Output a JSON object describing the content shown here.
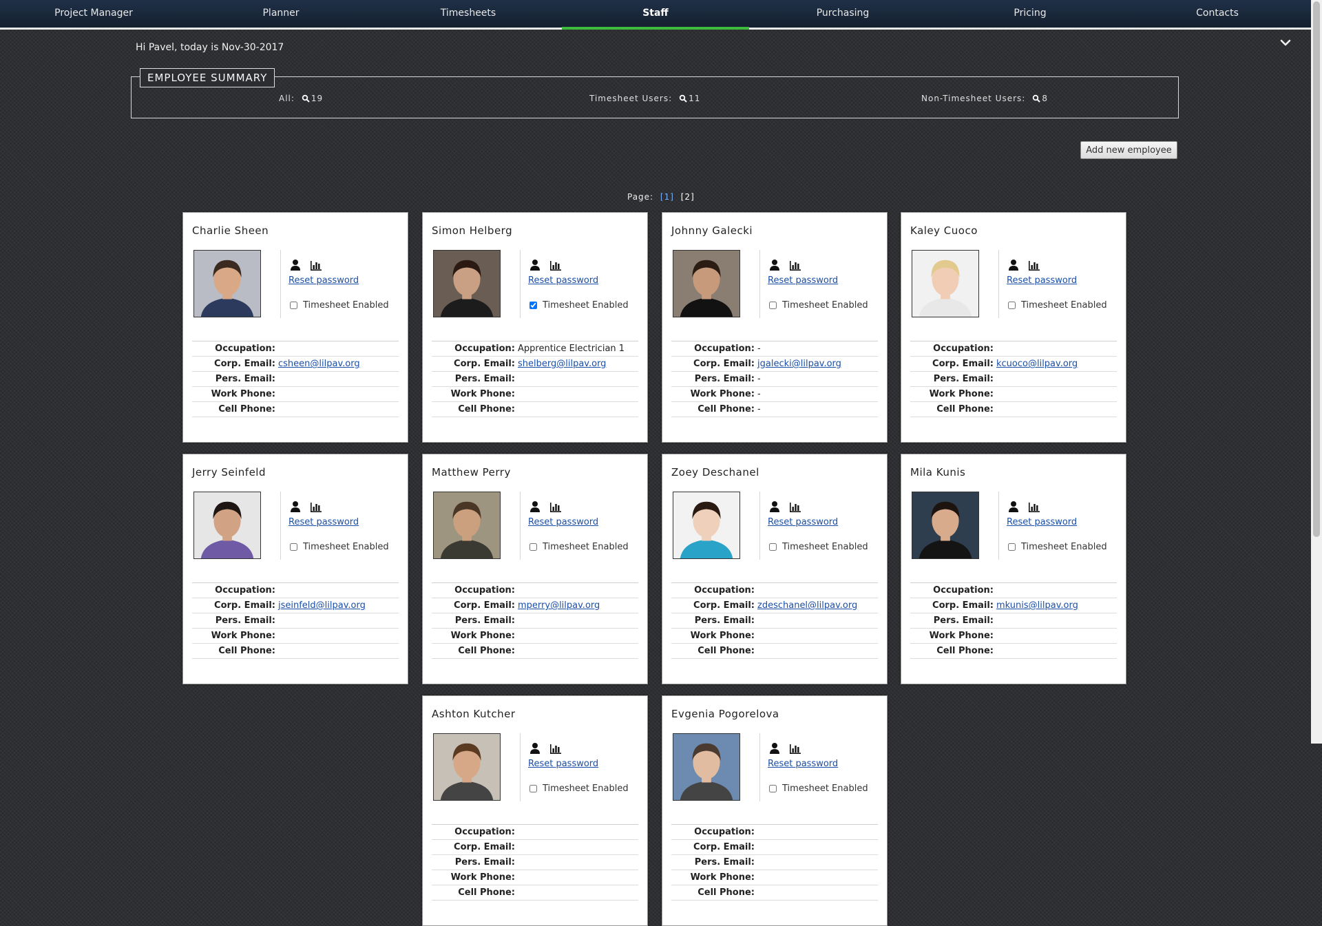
{
  "nav": [
    "Project Manager",
    "Planner",
    "Timesheets",
    "Staff",
    "Purchasing",
    "Pricing",
    "Contacts"
  ],
  "nav_active": "Staff",
  "greeting": "Hi Pavel, today is Nov-30-2017",
  "summary": {
    "title": "EMPLOYEE SUMMARY",
    "all_label": "All:",
    "all_count": "19",
    "ts_label": "Timesheet Users:",
    "ts_count": "11",
    "nts_label": "Non-Timesheet Users:",
    "nts_count": "8"
  },
  "add_button": "Add new employee",
  "pager": {
    "label": "Page:",
    "current": "[1]",
    "other": "[2]"
  },
  "card_labels": {
    "reset": "Reset password",
    "timesheet": "Timesheet Enabled",
    "occupation": "Occupation:",
    "corp_email": "Corp. Email:",
    "pers_email": "Pers. Email:",
    "work_phone": "Work Phone:",
    "cell_phone": "Cell Phone:"
  },
  "employees": [
    {
      "name": "Charlie Sheen",
      "timesheet": false,
      "occupation": "",
      "corp_email": "csheen@lilpav.org",
      "pers_email": "",
      "work_phone": "",
      "cell_phone": "",
      "hair": "#3a2a20",
      "skin": "#d9a987",
      "shirt": "#2c3a5e",
      "bg": "#b9bcc4"
    },
    {
      "name": "Simon Helberg",
      "timesheet": true,
      "occupation": "Apprentice Electrician 1",
      "corp_email": "shelberg@lilpav.org",
      "pers_email": "",
      "work_phone": "",
      "cell_phone": "",
      "hair": "#2a1a12",
      "skin": "#caa084",
      "shirt": "#1c1c1c",
      "bg": "#6a5e54"
    },
    {
      "name": "Johnny Galecki",
      "timesheet": false,
      "occupation": "-",
      "corp_email": "jgalecki@lilpav.org",
      "pers_email": "-",
      "work_phone": "-",
      "cell_phone": "-",
      "hair": "#2b1d14",
      "skin": "#c89a7c",
      "shirt": "#121212",
      "bg": "#8a7d72"
    },
    {
      "name": "Kaley Cuoco",
      "timesheet": false,
      "occupation": "",
      "corp_email": "kcuoco@lilpav.org",
      "pers_email": "",
      "work_phone": "",
      "cell_phone": "",
      "hair": "#e2c98e",
      "skin": "#f0cdb4",
      "shirt": "#e8e8e8",
      "bg": "#f1f1f1"
    },
    {
      "name": "Jerry Seinfeld",
      "timesheet": false,
      "occupation": "",
      "corp_email": "jseinfeld@lilpav.org",
      "pers_email": "",
      "work_phone": "",
      "cell_phone": "",
      "hair": "#1e1612",
      "skin": "#d1a283",
      "shirt": "#6f5aa6",
      "bg": "#e6e6e6"
    },
    {
      "name": "Matthew Perry",
      "timesheet": false,
      "occupation": "",
      "corp_email": "mperry@lilpav.org",
      "pers_email": "",
      "work_phone": "",
      "cell_phone": "",
      "hair": "#4a3624",
      "skin": "#caa07e",
      "shirt": "#3a3a32",
      "bg": "#9d9580"
    },
    {
      "name": "Zoey Deschanel",
      "timesheet": false,
      "occupation": "",
      "corp_email": "zdeschanel@lilpav.org",
      "pers_email": "",
      "work_phone": "",
      "cell_phone": "",
      "hair": "#2a1a12",
      "skin": "#efd0bb",
      "shirt": "#2aa3c9",
      "bg": "#f2f2f2"
    },
    {
      "name": "Mila Kunis",
      "timesheet": false,
      "occupation": "",
      "corp_email": "mkunis@lilpav.org",
      "pers_email": "",
      "work_phone": "",
      "cell_phone": "",
      "hair": "#1d1410",
      "skin": "#d8ab8c",
      "shirt": "#141414",
      "bg": "#2e3e4e"
    },
    {
      "name": "Ashton Kutcher",
      "timesheet": false,
      "occupation": "",
      "corp_email": "",
      "pers_email": "",
      "work_phone": "",
      "cell_phone": "",
      "hair": "#5a3a20",
      "skin": "#d7a888",
      "shirt": "#444",
      "bg": "#c6c0b6"
    },
    {
      "name": "Evgenia Pogorelova",
      "timesheet": false,
      "occupation": "",
      "corp_email": "",
      "pers_email": "",
      "work_phone": "",
      "cell_phone": "",
      "hair": "#4a3a30",
      "skin": "#e2bca0",
      "shirt": "#444",
      "bg": "#6d8bb0"
    }
  ]
}
